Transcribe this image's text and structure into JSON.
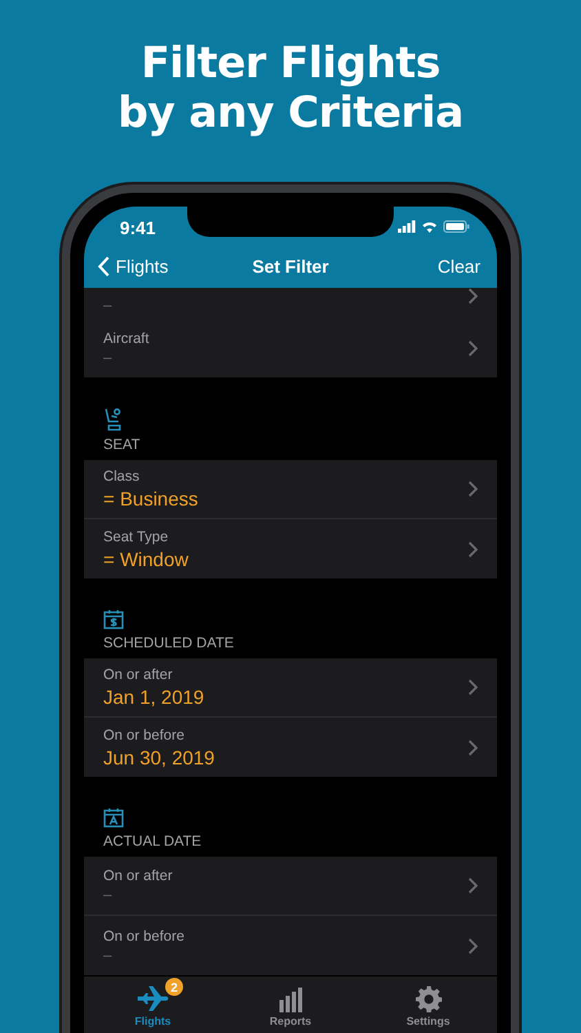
{
  "headline": [
    "Filter Flights",
    "by any Criteria"
  ],
  "status_bar": {
    "time": "9:41"
  },
  "nav": {
    "back": "Flights",
    "title": "Set Filter",
    "action": "Clear"
  },
  "sections": [
    {
      "kind": "partial",
      "rows": [
        {
          "value": "–",
          "set": false
        }
      ]
    },
    {
      "kind": "none",
      "rows": [
        {
          "label": "Aircraft",
          "value": "–",
          "set": false
        }
      ]
    },
    {
      "kind": "seat",
      "title": "SEAT",
      "rows": [
        {
          "label": "Class",
          "value": "= Business",
          "set": true
        },
        {
          "label": "Seat Type",
          "value": "= Window",
          "set": true
        }
      ]
    },
    {
      "kind": "scheduled",
      "title": "SCHEDULED DATE",
      "rows": [
        {
          "label": "On or after",
          "value": "Jan 1, 2019",
          "set": true
        },
        {
          "label": "On or before",
          "value": "Jun 30, 2019",
          "set": true
        }
      ]
    },
    {
      "kind": "actual",
      "title": "ACTUAL DATE",
      "rows": [
        {
          "label": "On or after",
          "value": "–",
          "set": false
        },
        {
          "label": "On or before",
          "value": "–",
          "set": false
        }
      ]
    }
  ],
  "tabs": [
    {
      "kind": "plane",
      "label": "Flights",
      "selected": true,
      "badge": "2"
    },
    {
      "kind": "chart",
      "label": "Reports",
      "selected": false
    },
    {
      "kind": "gear",
      "label": "Settings",
      "selected": false
    }
  ]
}
